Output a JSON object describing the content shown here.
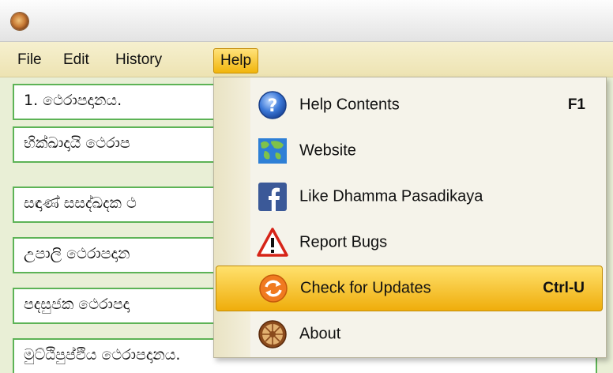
{
  "menubar": {
    "items": [
      {
        "label": "File"
      },
      {
        "label": "Edit"
      },
      {
        "label": "History"
      },
      {
        "label": "Help"
      }
    ]
  },
  "content": {
    "rows": [
      {
        "text": "1.  ථෙරාපදානය."
      },
      {
        "text": "භික්ඛාදායි ථෙරාප"
      },
      {
        "text": "සඳාණ් සසද්ඛදක ථ"
      },
      {
        "text": "උපාලි ථෙරාපදාන"
      },
      {
        "text": "පදසුජක ථෙරාපදා"
      },
      {
        "text": "මුට්ඨිපුප්ඵිය ථෙරාපදානය."
      }
    ]
  },
  "help_menu": {
    "items": [
      {
        "label": "Help Contents",
        "shortcut": "F1",
        "icon": "help-icon"
      },
      {
        "label": "Website",
        "shortcut": "",
        "icon": "globe-icon"
      },
      {
        "label": "Like Dhamma Pasadikaya",
        "shortcut": "",
        "icon": "facebook-icon"
      },
      {
        "label": "Report Bugs",
        "shortcut": "",
        "icon": "warning-icon"
      },
      {
        "label": "Check for Updates",
        "shortcut": "Ctrl-U",
        "icon": "update-icon"
      },
      {
        "label": "About",
        "shortcut": "",
        "icon": "dharma-wheel-icon"
      }
    ]
  },
  "colors": {
    "menu_highlight": "#f1b50c",
    "row_border": "#5db356",
    "background": "#e9efd6"
  }
}
